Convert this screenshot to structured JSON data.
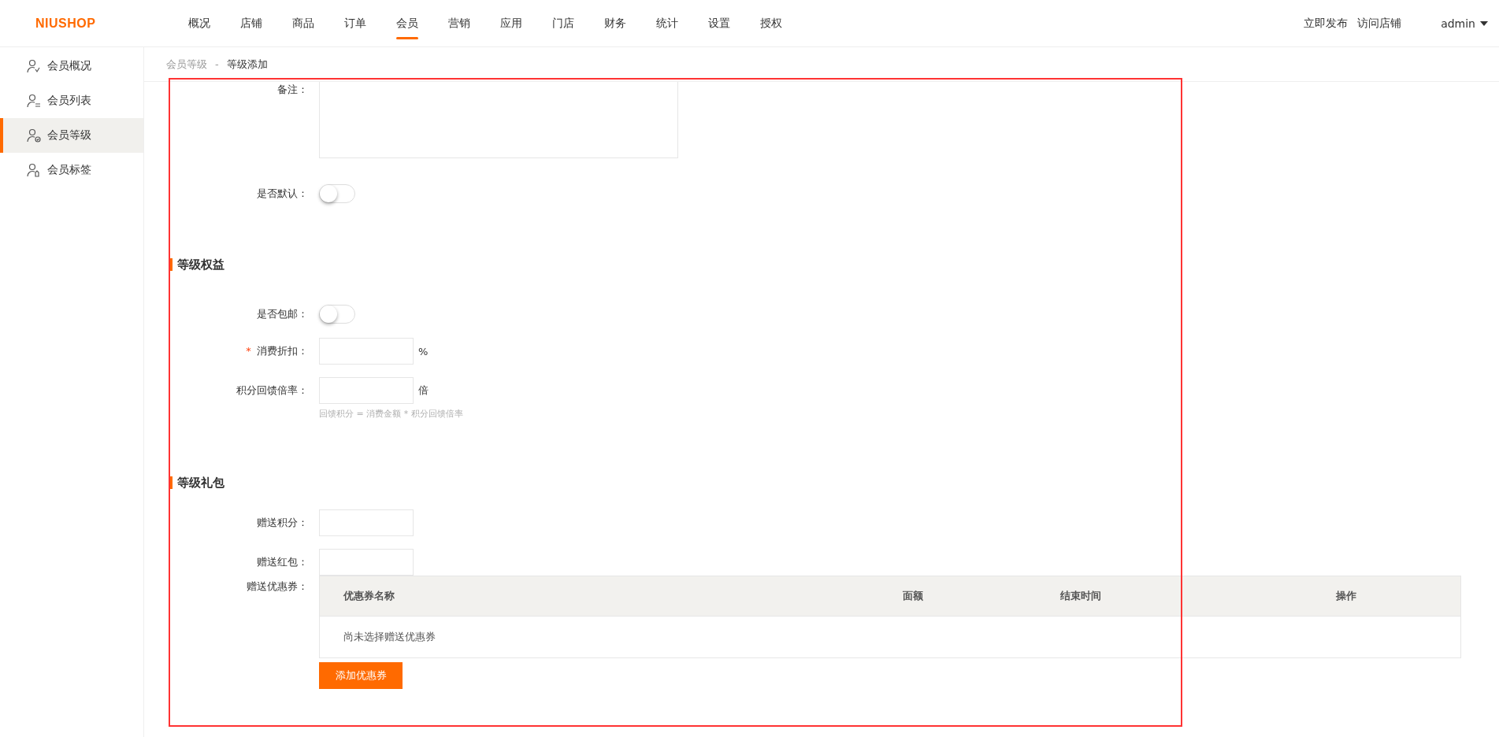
{
  "header": {
    "logo": "NIUSHOP",
    "nav": [
      {
        "label": "概况",
        "selected": false
      },
      {
        "label": "店铺",
        "selected": false
      },
      {
        "label": "商品",
        "selected": false
      },
      {
        "label": "订单",
        "selected": false
      },
      {
        "label": "会员",
        "selected": true
      },
      {
        "label": "营销",
        "selected": false
      },
      {
        "label": "应用",
        "selected": false
      },
      {
        "label": "门店",
        "selected": false
      },
      {
        "label": "财务",
        "selected": false
      },
      {
        "label": "统计",
        "selected": false
      },
      {
        "label": "设置",
        "selected": false
      },
      {
        "label": "授权",
        "selected": false
      }
    ],
    "actions": [
      "立即发布",
      "访问店铺"
    ],
    "user": "admin"
  },
  "sidebar": {
    "items": [
      {
        "label": "会员概况",
        "selected": false,
        "kind": "check"
      },
      {
        "label": "会员列表",
        "selected": false,
        "kind": "list"
      },
      {
        "label": "会员等级",
        "selected": true,
        "kind": "badge"
      },
      {
        "label": "会员标签",
        "selected": false,
        "kind": "tag"
      }
    ]
  },
  "breadcrumb": {
    "parent": "会员等级",
    "separator": "-",
    "current": "等级添加"
  },
  "form": {
    "rows": [
      {
        "kind": "textarea",
        "label": "备注："
      },
      {
        "kind": "toggle",
        "label": "是否默认：",
        "on": false
      },
      {
        "kind": "heading",
        "label": "等级权益"
      },
      {
        "kind": "toggle",
        "label": "是否包邮：",
        "on": false
      },
      {
        "kind": "input",
        "label": "消费折扣：",
        "required_mark": "*",
        "unit": "%"
      },
      {
        "kind": "input",
        "label": "积分回馈倍率：",
        "unit": "倍",
        "hint": "回馈积分 = 消费金额 * 积分回馈倍率"
      },
      {
        "kind": "heading",
        "label": "等级礼包"
      },
      {
        "kind": "input",
        "label": "赠送积分："
      },
      {
        "kind": "input",
        "label": "赠送红包："
      },
      {
        "kind": "coupons",
        "label": "赠送优惠券：",
        "columns": [
          "优惠券名称",
          "面额",
          "结束时间",
          "操作"
        ],
        "empty_text": "尚未选择赠送优惠券",
        "button": "添加优惠券"
      }
    ]
  }
}
